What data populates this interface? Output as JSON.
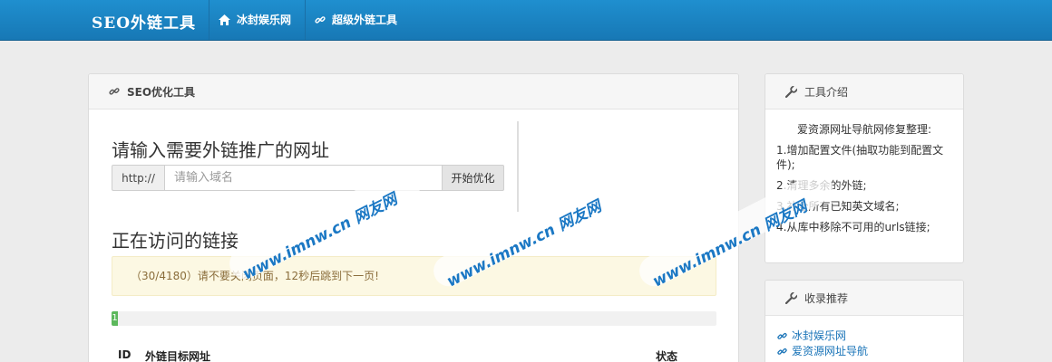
{
  "navbar": {
    "brand": "SEO外链工具",
    "items": [
      {
        "label": "冰封娱乐网",
        "icon": "home-icon"
      },
      {
        "label": "超级外链工具",
        "icon": "link-icon"
      }
    ]
  },
  "main": {
    "heading": "SEO优化工具",
    "heading_icon": "link-icon",
    "input_title": "请输入需要外链推广的网址",
    "url_prefix": "http://",
    "url_placeholder": "请输入域名",
    "submit_label": "开始优化",
    "visiting_title": "正在访问的链接",
    "alert_text": "（30/4180）请不要关闭页面，12秒后跳到下一页!",
    "progress": {
      "label": "1",
      "fraction": 0.007
    },
    "table_headers": {
      "id": "ID",
      "target": "外链目标网址",
      "status": "状态"
    }
  },
  "side_intro": {
    "heading": "工具介绍",
    "heading_icon": "wrench-icon",
    "title": "爱资源网址导航网修复整理:",
    "lines": [
      "1.增加配置文件(抽取功能到配置文件);",
      "2.清理多余的外链;",
      "3.补全所有已知英文域名;",
      "4.从库中移除不可用的urls链接;"
    ]
  },
  "side_recommend": {
    "heading": "收录推荐",
    "heading_icon": "wrench-icon",
    "links": [
      "冰封娱乐网",
      "爱资源网址导航"
    ]
  },
  "watermark": {
    "text": "www.imnw.cn 网友网",
    "color": "#1b78c4"
  },
  "colors": {
    "navbar": "#1a84c4",
    "progress": "#5cb85c",
    "alert_bg": "#fcf8e3",
    "link": "#1a74b8"
  }
}
